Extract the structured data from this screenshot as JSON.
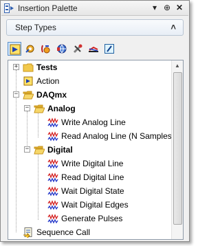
{
  "window": {
    "title": "Insertion Palette",
    "pin_glyph": "⊕",
    "dropdown_glyph": "▾",
    "close_glyph": "✕"
  },
  "section": {
    "label": "Step Types",
    "collapse_glyph": "˄"
  },
  "toolbar": {
    "tools": [
      {
        "name": "insert-step-icon",
        "selected": true
      },
      {
        "name": "settings-steps-icon"
      },
      {
        "name": "variables-icon"
      },
      {
        "name": "globe-icon"
      },
      {
        "name": "tools-icon"
      },
      {
        "name": "signal-icon"
      },
      {
        "name": "edit-icon"
      }
    ]
  },
  "tree": {
    "items": [
      {
        "label": "Tests",
        "bold": true,
        "expander": "+"
      },
      {
        "label": "Action"
      },
      {
        "label": "DAQmx",
        "bold": true,
        "expander": "−"
      },
      {
        "label": "Analog",
        "bold": true,
        "expander": "−"
      },
      {
        "label": "Write Analog Line"
      },
      {
        "label": "Read Analog Line (N Samples)"
      },
      {
        "label": "Digital",
        "bold": true,
        "expander": "−"
      },
      {
        "label": "Write Digital Line"
      },
      {
        "label": "Read Digital Line"
      },
      {
        "label": "Wait Digital State"
      },
      {
        "label": "Wait Digital Edges"
      },
      {
        "label": "Generate Pulses"
      },
      {
        "label": "Sequence Call"
      }
    ],
    "scroll_up_glyph": "▲"
  },
  "colors": {
    "folder": "#f2c94c",
    "folder_border": "#c8961e",
    "wave_red": "#d42020",
    "wave_blue": "#2034c8"
  }
}
